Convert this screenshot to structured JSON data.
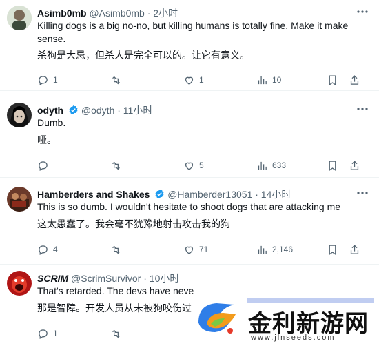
{
  "tweets": [
    {
      "name": "Asimb0mb",
      "handle": "@Asimb0mb",
      "time": "· 2小时",
      "text": "Killing dogs is a big no-no, but killing humans is totally fine. Make it make sense.",
      "translation": "杀狗是大忌，但杀人是完全可以的。让它有意义。",
      "replies": "1",
      "likes": "1",
      "views": "10"
    },
    {
      "name": "odyth",
      "handle": "@odyth",
      "time": "· 11小时",
      "text": "Dumb.",
      "translation": "哑。",
      "likes": "5",
      "views": "633"
    },
    {
      "name": "Hamberders and Shakes",
      "handle": "@Hamberder13051",
      "time": "· 14小时",
      "text": "This is so dumb. I wouldn't hesitate to shoot dogs that are attacking me",
      "translation": "这太愚蠢了。我会毫不犹豫地射击攻击我的狗",
      "replies": "4",
      "likes": "71",
      "views": "2,146"
    },
    {
      "name": "SCRIM",
      "handle": "@ScrimSurvivor",
      "time": "· 10小时",
      "text": "That's retarded. The devs have neve",
      "translation": "那是智障。开发人员从未被狗咬伤过",
      "replies": "1"
    }
  ],
  "watermark": {
    "title": "金利新游网",
    "url": "www.jlnseeds.com"
  },
  "colors": {
    "verified": "#1d9bf0",
    "icon": "#536471",
    "divider": "#eff3f4"
  }
}
